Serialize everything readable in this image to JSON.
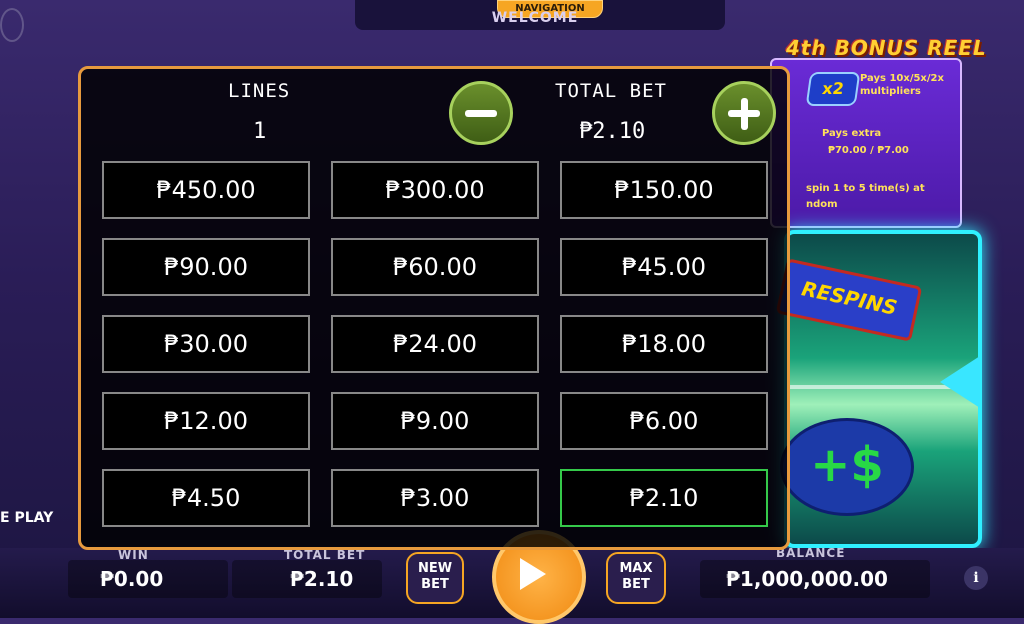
{
  "header": {
    "nav_label": "NAVIGATION",
    "welcome": "WELCOME"
  },
  "bonus": {
    "title": "4th BONUS REEL",
    "x2": "x2",
    "line1": "Pays 10x/5x/2x multipliers",
    "line2": "Pays extra",
    "line3": "₱70.00 / ₱7.00",
    "line4": "spin 1 to 5 time(s) at",
    "line5": "ndom",
    "respins": "RESPINS",
    "dollar": "+$"
  },
  "left_label": "E PLAY",
  "bet_panel": {
    "lines_label": "LINES",
    "lines_value": "1",
    "total_bet_label": "TOTAL BET",
    "total_bet_value": "₱2.10",
    "options": [
      [
        "₱450.00",
        "₱300.00",
        "₱150.00"
      ],
      [
        "₱90.00",
        "₱60.00",
        "₱45.00"
      ],
      [
        "₱30.00",
        "₱24.00",
        "₱18.00"
      ],
      [
        "₱12.00",
        "₱9.00",
        "₱6.00"
      ],
      [
        "₱4.50",
        "₱3.00",
        "₱2.10"
      ]
    ],
    "selected": "₱2.10"
  },
  "bottom": {
    "win_label": "WIN",
    "win_value": "₱0.00",
    "total_bet_label": "TOTAL BET",
    "total_bet_value": "₱2.10",
    "new_bet": "NEW BET",
    "max_bet": "MAX BET",
    "balance_label": "BALANCE",
    "balance_value": "₱1,000,000.00",
    "info": "i"
  },
  "colors": {
    "panel_border": "#e79a3e",
    "selected_border": "#35c94a",
    "accent_green": "#6a8f2c"
  }
}
